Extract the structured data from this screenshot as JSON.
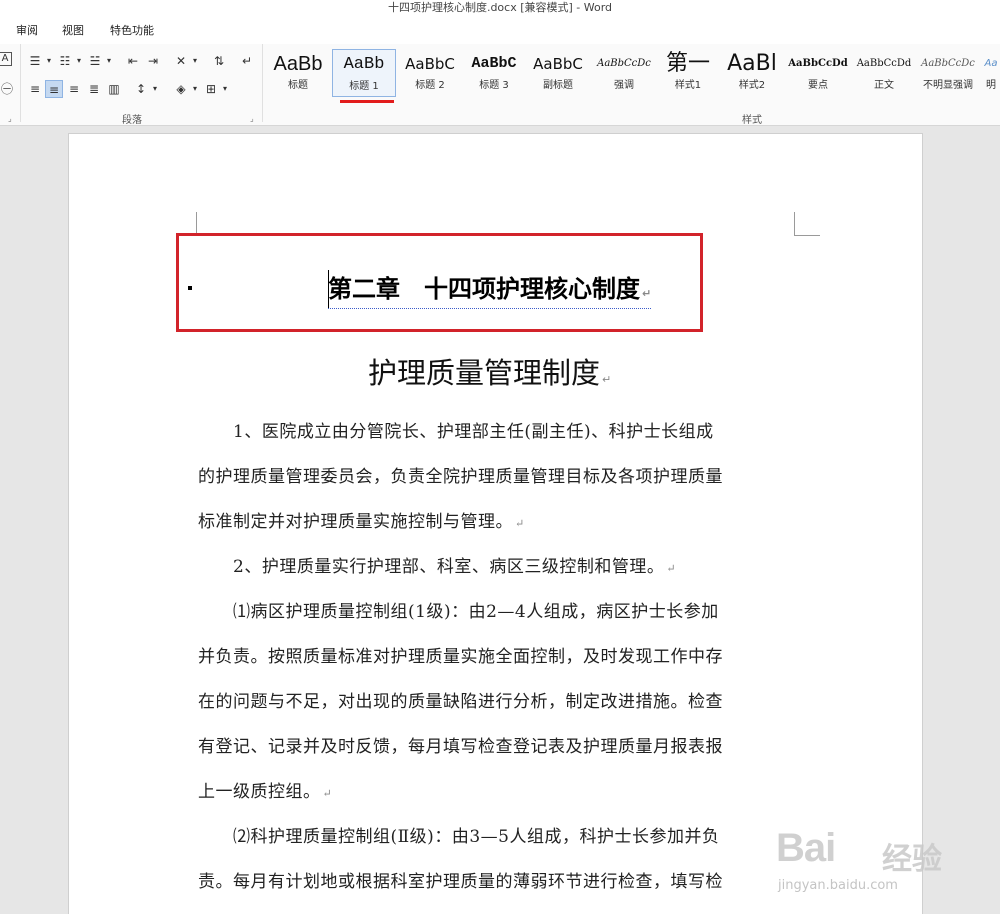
{
  "window": {
    "title": "十四项护理核心制度.docx [兼容模式] - Word"
  },
  "tabs": [
    "审阅",
    "视图",
    "特色功能"
  ],
  "ribbon": {
    "paragraph_group_label": "段落",
    "styles_group_label": "样式",
    "styles": [
      {
        "preview": "AaBb",
        "name": "标题"
      },
      {
        "preview": "AaBb",
        "name": "标题 1",
        "selected": true
      },
      {
        "preview": "AaBbC",
        "name": "标题 2"
      },
      {
        "preview": "AaBbC",
        "name": "标题 3"
      },
      {
        "preview": "AaBbC",
        "name": "副标题"
      },
      {
        "preview": "AaBbCcDc",
        "name": "强调"
      },
      {
        "preview": "第一",
        "name": "样式1"
      },
      {
        "preview": "AaBl",
        "name": "样式2"
      },
      {
        "preview": "AaBbCcDd",
        "name": "要点"
      },
      {
        "preview": "AaBbCcDd",
        "name": "正文"
      },
      {
        "preview": "AaBbCcDc",
        "name": "不明显强调"
      },
      {
        "preview": "Aa",
        "name": "明"
      }
    ]
  },
  "document": {
    "chapter_heading": "第二章　十四项护理核心制度",
    "title": "护理质量管理制度",
    "lines": [
      "　　1、医院成立由分管院长、护理部主任(副主任)、科护士长组成",
      "的护理质量管理委员会，负责全院护理质量管理目标及各项护理质量",
      "标准制定并对护理质量实施控制与管理。",
      "　　2、护理质量实行护理部、科室、病区三级控制和管理。",
      "　　⑴病区护理质量控制组(1级)：由2—4人组成，病区护士长参加",
      "并负责。按照质量标准对护理质量实施全面控制，及时发现工作中存",
      "在的问题与不足，对出现的质量缺陷进行分析，制定改进措施。检查",
      "有登记、记录并及时反馈，每月填写检查登记表及护理质量月报表报",
      "上一级质控组。",
      "　　⑵科护理质量控制组(Ⅱ级)：由3—5人组成，科护士长参加并负",
      "责。每月有计划地或根据科室护理质量的薄弱环节进行检查，填写检"
    ],
    "paragraph_end_lines": [
      2,
      3,
      8
    ]
  },
  "watermark": {
    "logo": "Bai",
    "text": "经验",
    "url": "jingyan.baidu.com"
  }
}
